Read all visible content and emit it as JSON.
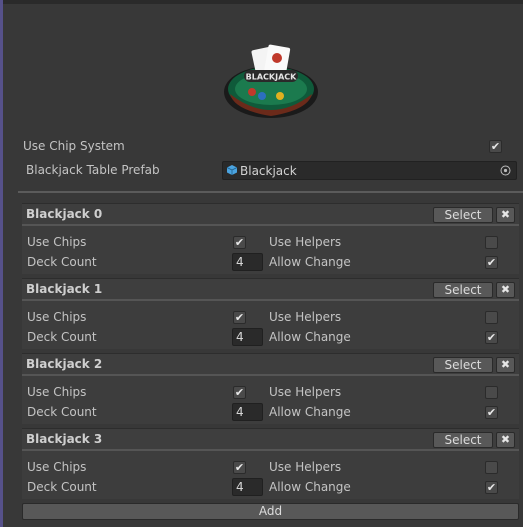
{
  "logo": {
    "text": "BLACKJACK",
    "icon": "blackjack-table-logo"
  },
  "settings": {
    "use_chip_system_label": "Use Chip System",
    "use_chip_system_checked": true,
    "table_prefab_label": "Blackjack Table Prefab",
    "table_prefab_value": "Blackjack"
  },
  "tables": [
    {
      "title": "Blackjack 0",
      "use_chips": true,
      "use_helpers": false,
      "deck_count": "4",
      "allow_change": true
    },
    {
      "title": "Blackjack 1",
      "use_chips": true,
      "use_helpers": false,
      "deck_count": "4",
      "allow_change": true
    },
    {
      "title": "Blackjack 2",
      "use_chips": true,
      "use_helpers": false,
      "deck_count": "4",
      "allow_change": true
    },
    {
      "title": "Blackjack 3",
      "use_chips": true,
      "use_helpers": false,
      "deck_count": "4",
      "allow_change": true
    }
  ],
  "labels": {
    "select": "Select",
    "remove": "✖",
    "use_chips": "Use Chips",
    "use_helpers": "Use Helpers",
    "deck_count": "Deck Count",
    "allow_change": "Allow Change",
    "add": "Add"
  },
  "colors": {
    "background": "#383838",
    "panel_header": "#3e3e3e",
    "button": "#585858",
    "field": "#2a2a2a",
    "accent_edge": "#56518a"
  }
}
